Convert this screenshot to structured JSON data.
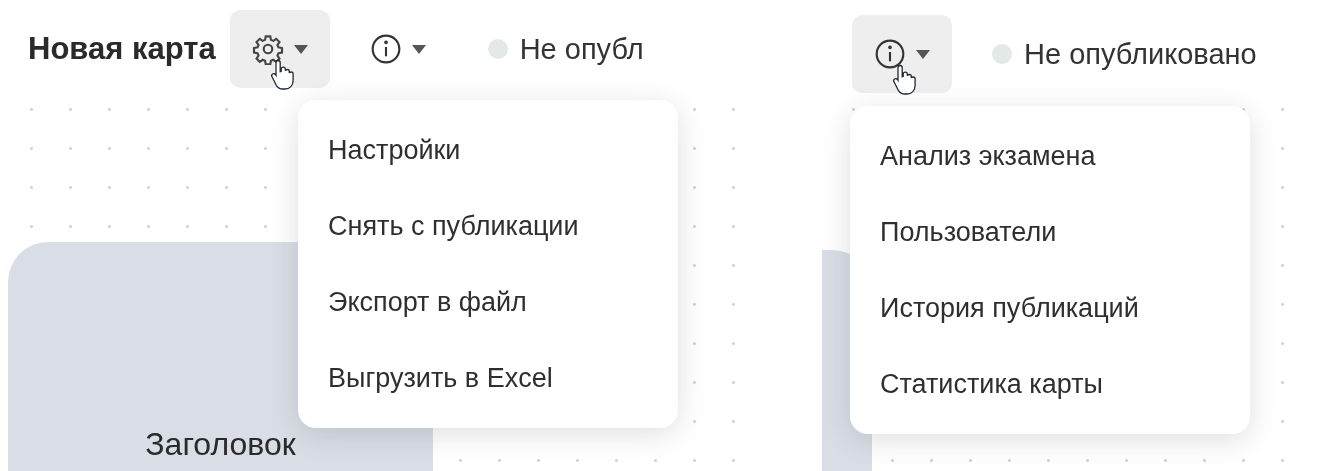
{
  "panels": [
    {
      "title": "Новая карта",
      "buttons": [
        {
          "kind": "gear",
          "selected": true
        },
        {
          "kind": "info",
          "selected": false
        }
      ],
      "status": {
        "text": "Не опубл"
      },
      "menu": {
        "items": [
          "Настройки",
          "Снять с публикации",
          "Экспорт в файл",
          "Выгрузить в Excel"
        ]
      },
      "card": {
        "title": "Заголовок"
      }
    },
    {
      "buttons": [
        {
          "kind": "info",
          "selected": true
        }
      ],
      "status": {
        "text": "Не опубликовано"
      },
      "menu": {
        "items": [
          "Анализ экзамена",
          "Пользователи",
          "История публикаций",
          "Статистика карты"
        ]
      },
      "card": {
        "shown": true
      }
    }
  ]
}
